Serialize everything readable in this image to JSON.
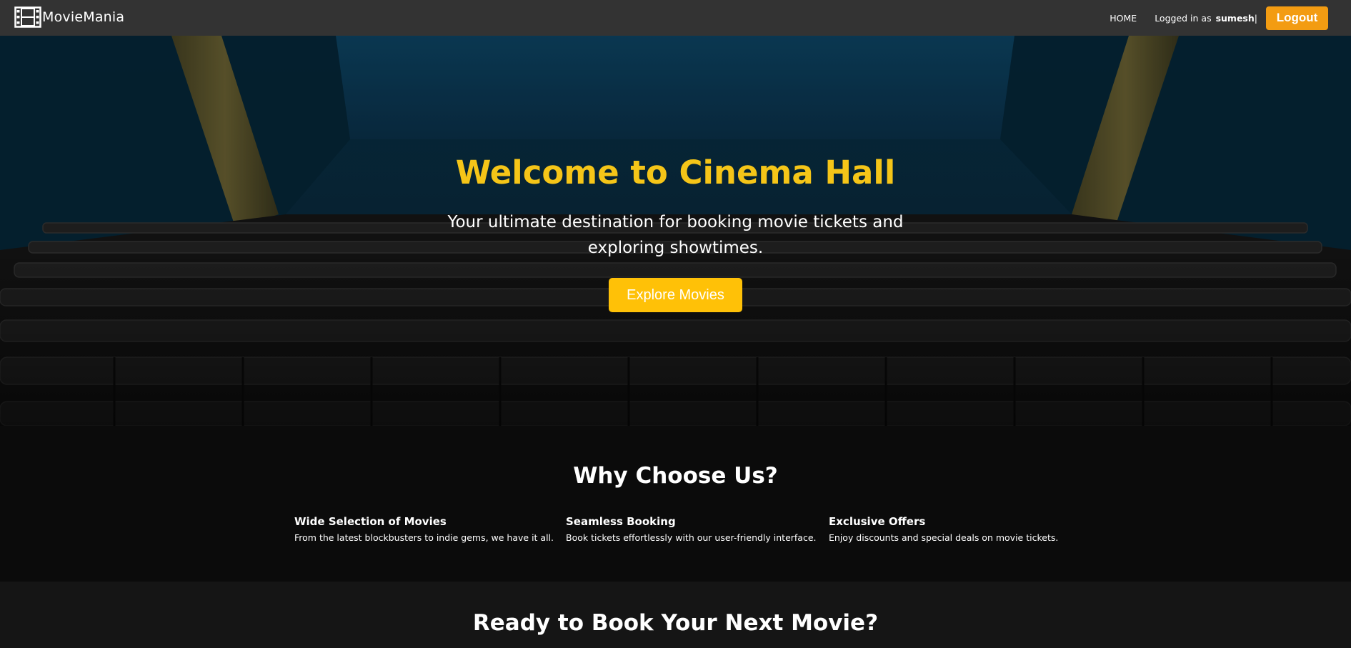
{
  "brand": {
    "name": "MovieMania",
    "icon": "film-reel-icon"
  },
  "nav": {
    "home": "HOME",
    "logged_in_label": "Logged in as",
    "username": "sumesh",
    "separator": "|",
    "logout": "Logout"
  },
  "hero": {
    "title": "Welcome to Cinema Hall",
    "subtitle": "Your ultimate destination for booking movie tickets and exploring showtimes.",
    "cta": "Explore Movies"
  },
  "features": {
    "title": "Why Choose Us?",
    "items": [
      {
        "title": "Wide Selection of Movies",
        "desc": "From the latest blockbusters to indie gems, we have it all."
      },
      {
        "title": "Seamless Booking",
        "desc": "Book tickets effortlessly with our user-friendly interface."
      },
      {
        "title": "Exclusive Offers",
        "desc": "Enjoy discounts and special deals on movie tickets."
      }
    ]
  },
  "cta": {
    "title": "Ready to Book Your Next Movie?"
  },
  "colors": {
    "navbar": "#333333",
    "accent": "#f5c518",
    "logout": "#f39c12",
    "button": "#ffc107",
    "dark_bg": "#0b0b0b"
  }
}
